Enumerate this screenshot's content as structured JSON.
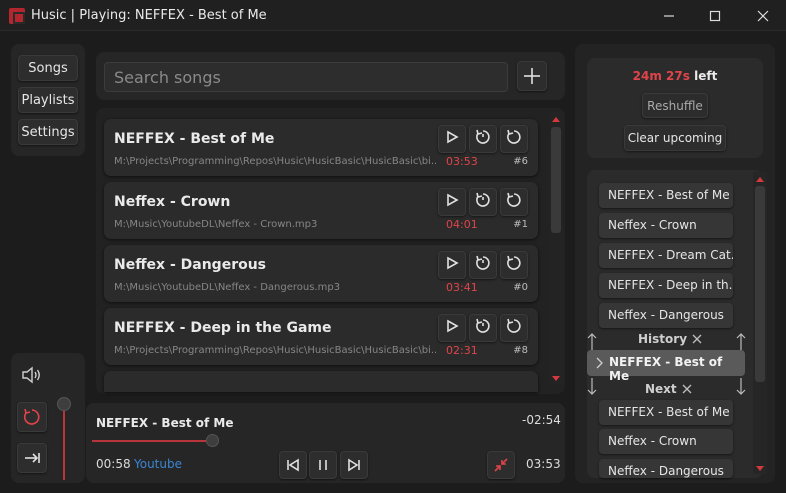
{
  "window": {
    "title": "Husic | Playing: NEFFEX - Best of Me"
  },
  "nav": {
    "songs": "Songs",
    "playlists": "Playlists",
    "settings": "Settings"
  },
  "search": {
    "placeholder": "Search songs",
    "value": ""
  },
  "songs": [
    {
      "title": "NEFFEX - Best of Me",
      "path": "M:\\Projects\\Programming\\Repos\\Husic\\HusicBasic\\HusicBasic\\bi...",
      "duration": "03:53",
      "index": "#6"
    },
    {
      "title": "Neffex - Crown",
      "path": "M:\\Music\\YoutubeDL\\Neffex - Crown.mp3",
      "duration": "04:01",
      "index": "#1"
    },
    {
      "title": "Neffex - Dangerous",
      "path": "M:\\Music\\YoutubeDL\\Neffex - Dangerous.mp3",
      "duration": "03:41",
      "index": "#0"
    },
    {
      "title": "NEFFEX - Deep in the Game",
      "path": "M:\\Projects\\Programming\\Repos\\Husic\\HusicBasic\\HusicBasic\\bi...",
      "duration": "02:31",
      "index": "#8"
    }
  ],
  "queue_info": {
    "time_left": "24m 27s",
    "left_word": "left",
    "reshuffle": "Reshuffle",
    "clear": "Clear upcoming"
  },
  "queue": {
    "history": [
      "NEFFEX - Best of Me",
      "Neffex - Crown",
      "NEFFEX - Dream Cat...",
      "NEFFEX - Deep in th...",
      "Neffex - Dangerous"
    ],
    "history_label": "History",
    "current": "NEFFEX - Best of Me",
    "next_label": "Next",
    "next": [
      "NEFFEX - Best of Me",
      "Neffex - Crown",
      "Neffex - Dangerous"
    ]
  },
  "player": {
    "song": "NEFFEX - Best of Me",
    "remaining": "-02:54",
    "elapsed": "00:58",
    "source": "Youtube",
    "total": "03:53",
    "progress": 0.25
  },
  "colors": {
    "accent": "#e0444a",
    "link": "#3a86d4"
  }
}
